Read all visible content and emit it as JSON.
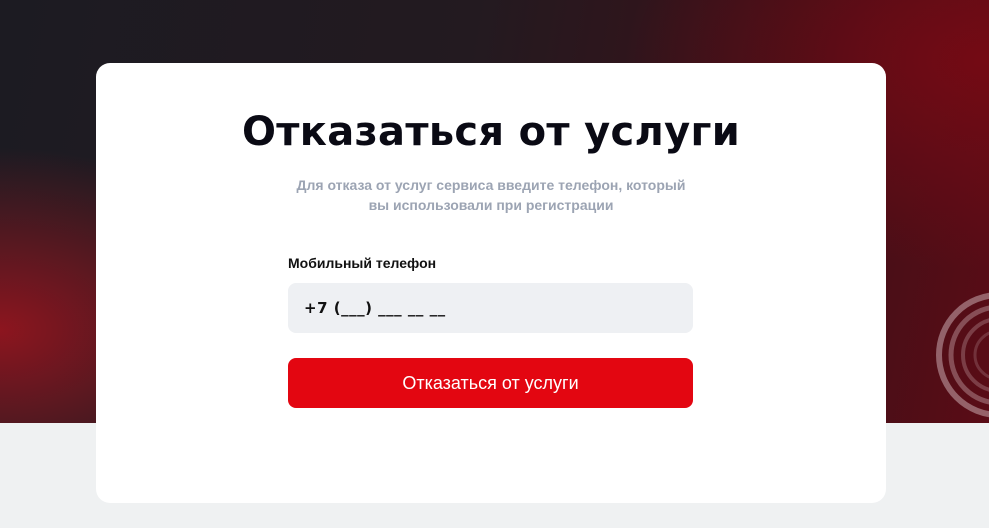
{
  "page": {
    "title": "Отказаться от услуги",
    "subtitle_lines": [
      "Для отказа от услуг сервиса введите телефон, который",
      "вы использовали при регистрации"
    ]
  },
  "form": {
    "phone_label": "Мобильный телефон",
    "phone_value": "+7 (___) ___ __ __",
    "submit_label": "Отказаться от услуги"
  },
  "colors": {
    "accent": "#e30611",
    "input_bg": "#eef0f3",
    "hero_dark": "#1c1b22",
    "hero_red": "#5a0c16"
  }
}
